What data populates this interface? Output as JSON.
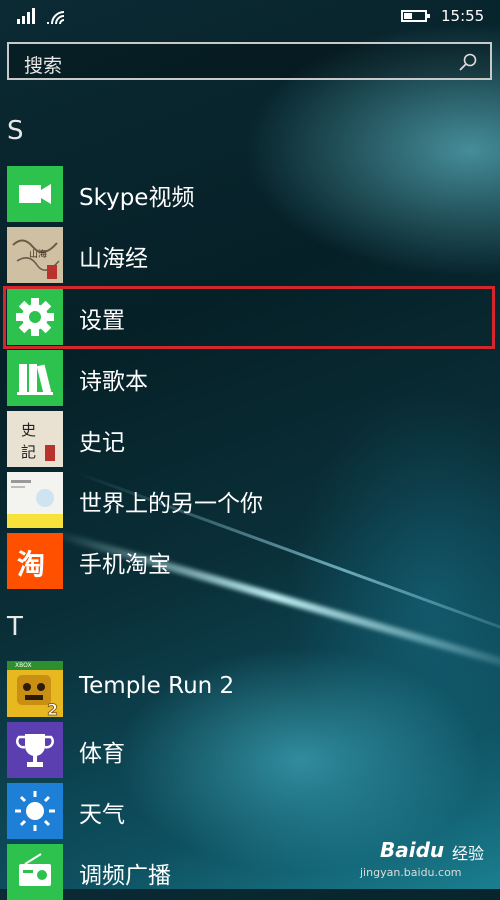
{
  "status_bar": {
    "time": "15:55",
    "battery_level": 0.45
  },
  "search": {
    "placeholder": "搜索"
  },
  "sections": [
    {
      "letter": "S"
    },
    {
      "letter": "T"
    }
  ],
  "apps": [
    {
      "label": "Skype视频",
      "icon": "video-camera-icon",
      "color": "#2dc24e"
    },
    {
      "label": "山海经",
      "icon": "book-cover-icon",
      "color": "#d8cbb2"
    },
    {
      "label": "设置",
      "icon": "gear-icon",
      "color": "#2dc24e",
      "highlighted": true
    },
    {
      "label": "诗歌本",
      "icon": "books-icon",
      "color": "#2dc24e"
    },
    {
      "label": "史记",
      "icon": "book-cover-icon",
      "color": "#e9e2d2",
      "cover_text": "史記"
    },
    {
      "label": "世界上的另一个你",
      "icon": "book-cover-icon",
      "color": "#f3f3f0"
    },
    {
      "label": "手机淘宝",
      "icon": "taobao-icon",
      "color": "#ff5000",
      "cover_text": "淘"
    },
    {
      "label": "Temple Run 2",
      "icon": "game-icon",
      "color": "#e8b820",
      "cover_text": "XBOX"
    },
    {
      "label": "体育",
      "icon": "trophy-icon",
      "color": "#5b3fb0"
    },
    {
      "label": "天气",
      "icon": "sun-icon",
      "color": "#1e7fd6"
    },
    {
      "label": "调频广播",
      "icon": "radio-icon",
      "color": "#2dc24e"
    }
  ],
  "watermark": {
    "brand_left": "Bai",
    "brand_right": "du",
    "suffix": "经验",
    "url": "jingyan.baidu.com"
  }
}
